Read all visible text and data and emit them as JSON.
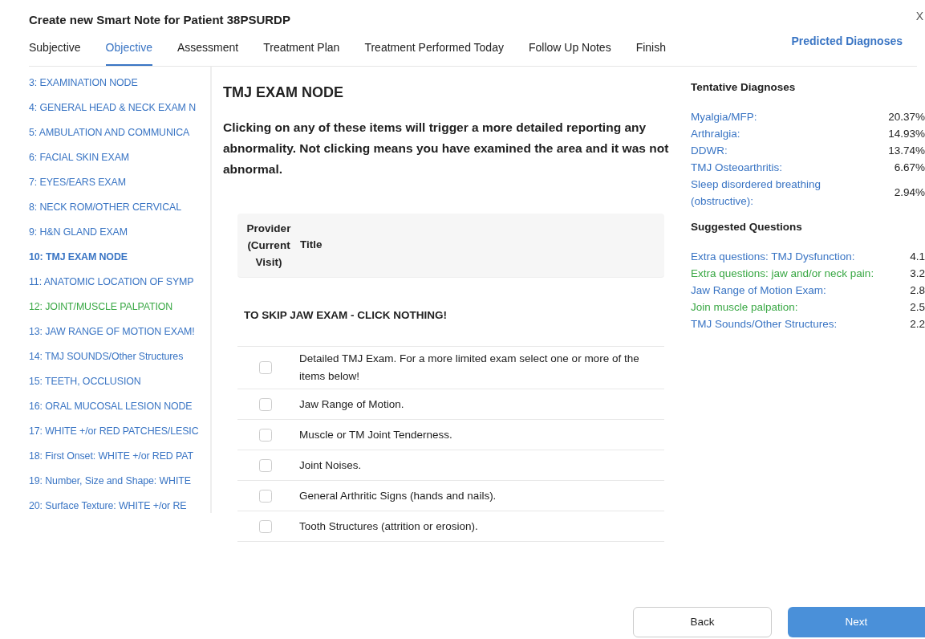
{
  "window": {
    "title": "Create new Smart Note for Patient 38PSURDP",
    "close": "X"
  },
  "tabs": [
    {
      "label": "Subjective",
      "selected": false
    },
    {
      "label": "Objective",
      "selected": true
    },
    {
      "label": "Assessment",
      "selected": false
    },
    {
      "label": "Treatment Plan",
      "selected": false
    },
    {
      "label": "Treatment Performed Today",
      "selected": false
    },
    {
      "label": "Follow Up Notes",
      "selected": false
    },
    {
      "label": "Finish",
      "selected": false
    }
  ],
  "predicted_link": "Predicted Diagnoses",
  "sidebar": {
    "items": [
      {
        "label": "3: EXAMINATION NODE",
        "selected": false,
        "color": "#3a75c4"
      },
      {
        "label": "4: GENERAL HEAD & NECK EXAM N",
        "selected": false,
        "color": "#3a75c4"
      },
      {
        "label": "5: AMBULATION AND COMMUNICA",
        "selected": false,
        "color": "#3a75c4"
      },
      {
        "label": "6: FACIAL SKIN EXAM",
        "selected": false,
        "color": "#3a75c4"
      },
      {
        "label": "7: EYES/EARS EXAM",
        "selected": false,
        "color": "#3a75c4"
      },
      {
        "label": "8: NECK ROM/OTHER CERVICAL",
        "selected": false,
        "color": "#3a75c4"
      },
      {
        "label": "9: H&N GLAND EXAM",
        "selected": false,
        "color": "#3a75c4"
      },
      {
        "label": "10: TMJ EXAM NODE",
        "selected": true,
        "color": "#3a75c4"
      },
      {
        "label": "11: ANATOMIC LOCATION OF SYMP",
        "selected": false,
        "color": "#3a75c4"
      },
      {
        "label": "12: JOINT/MUSCLE PALPATION",
        "selected": false,
        "color": "#3aa845"
      },
      {
        "label": "13: JAW RANGE OF MOTION EXAM!",
        "selected": false,
        "color": "#3a75c4"
      },
      {
        "label": "14: TMJ SOUNDS/Other Structures",
        "selected": false,
        "color": "#3a75c4"
      },
      {
        "label": "15: TEETH, OCCLUSION",
        "selected": false,
        "color": "#3a75c4"
      },
      {
        "label": "16: ORAL MUCOSAL LESION NODE",
        "selected": false,
        "color": "#3a75c4"
      },
      {
        "label": "17: WHITE +/or RED PATCHES/LESIC",
        "selected": false,
        "color": "#3a75c4"
      },
      {
        "label": "18: First Onset: WHITE +/or RED PAT",
        "selected": false,
        "color": "#3a75c4"
      },
      {
        "label": "19: Number, Size and Shape: WHITE",
        "selected": false,
        "color": "#3a75c4"
      },
      {
        "label": "20: Surface Texture: WHITE +/or RE",
        "selected": false,
        "color": "#3a75c4"
      }
    ]
  },
  "node": {
    "title": "TMJ EXAM NODE",
    "instructions": "Clicking on any of these items will trigger a more detailed reporting any abnormality. Not clicking means you have examined the area and it was not abnormal.",
    "table": {
      "columns": [
        "Provider (Current Visit)",
        "Title"
      ],
      "section": "TO SKIP JAW EXAM - CLICK NOTHING!",
      "rows": [
        {
          "title": "Detailed TMJ Exam. For a more limited exam select one or more of the items below!",
          "checked": false
        },
        {
          "title": "Jaw Range of Motion.",
          "checked": false
        },
        {
          "title": "Muscle or TM Joint Tenderness.",
          "checked": false
        },
        {
          "title": "Joint Noises.",
          "checked": false
        },
        {
          "title": "General Arthritic Signs (hands and nails).",
          "checked": false
        },
        {
          "title": "Tooth Structures (attrition or erosion).",
          "checked": false
        }
      ]
    }
  },
  "tentative_diagnoses": {
    "title": "Tentative Diagnoses",
    "items": [
      {
        "name": "Myalgia/MFP:",
        "value": "20.37%"
      },
      {
        "name": "Arthralgia:",
        "value": "14.93%"
      },
      {
        "name": "DDWR:",
        "value": "13.74%"
      },
      {
        "name": "TMJ Osteoarthritis:",
        "value": "6.67%"
      },
      {
        "name": "Sleep disordered breathing (obstructive):",
        "value": "2.94%"
      }
    ]
  },
  "suggested_questions": {
    "title": "Suggested Questions",
    "items": [
      {
        "name": "Extra questions: TMJ Dysfunction:",
        "value": "4.1",
        "color": "#3a75c4"
      },
      {
        "name": "Extra questions: jaw and/or neck pain:",
        "value": "3.2",
        "color": "#3aa845"
      },
      {
        "name": "Jaw Range of Motion Exam:",
        "value": "2.8",
        "color": "#3a75c4"
      },
      {
        "name": "Join muscle palpation:",
        "value": "2.5",
        "color": "#3aa845"
      },
      {
        "name": "TMJ Sounds/Other Structures:",
        "value": "2.2",
        "color": "#3a75c4"
      }
    ]
  },
  "buttons": {
    "back": "Back",
    "next": "Next"
  }
}
